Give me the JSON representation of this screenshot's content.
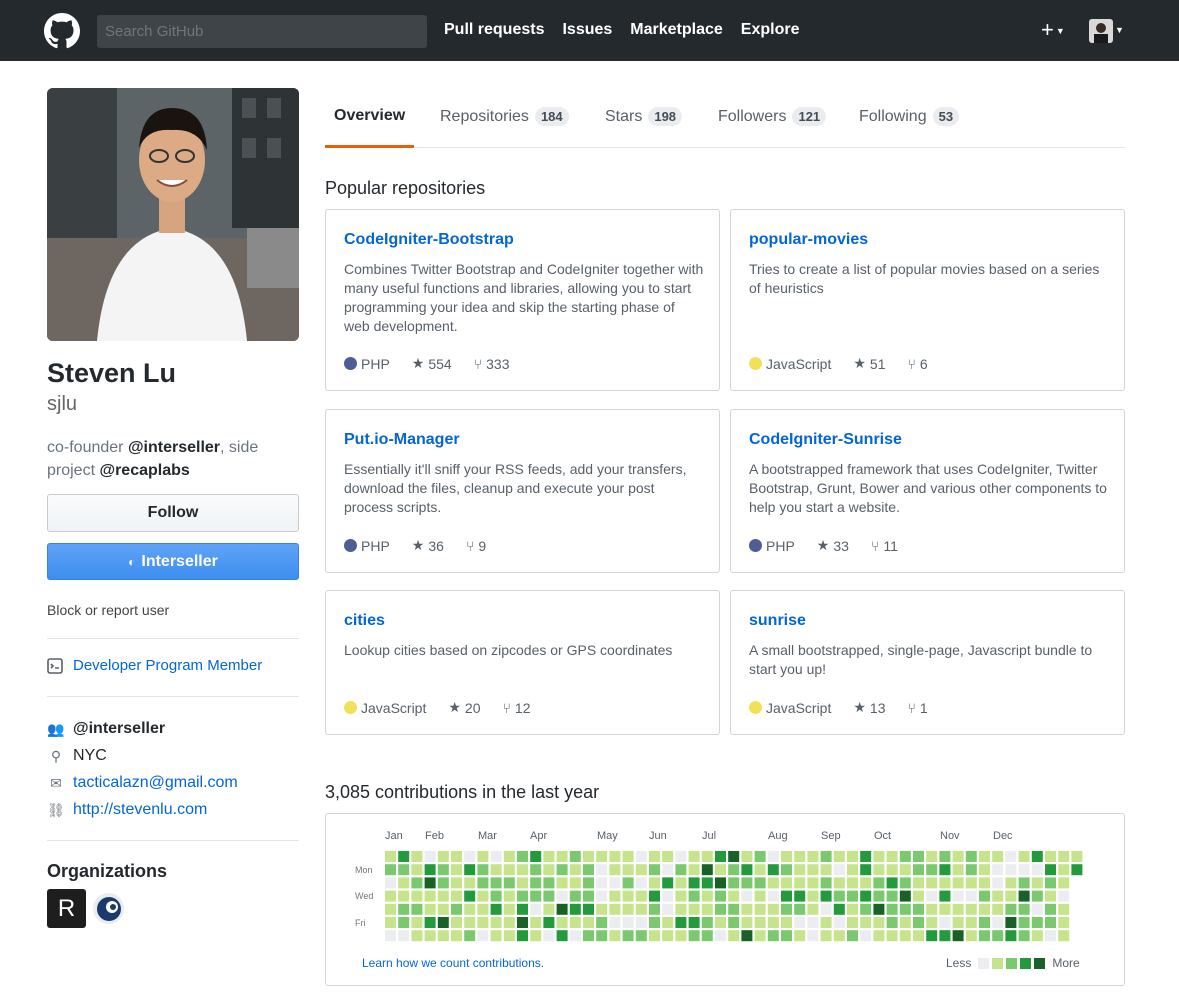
{
  "header": {
    "search_placeholder": "Search GitHub",
    "nav": [
      "Pull requests",
      "Issues",
      "Marketplace",
      "Explore"
    ],
    "plus": "+"
  },
  "profile": {
    "name": "Steven Lu",
    "login": "sjlu",
    "bio_prefix": "co-founder ",
    "bio_org1": "@interseller",
    "bio_mid": ", side project ",
    "bio_org2": "@recaplabs",
    "follow_label": "Follow",
    "org_button_label": "Interseller",
    "block_label": "Block or report user",
    "developer_label": "Developer Program Member",
    "company": "@interseller",
    "location": "NYC",
    "email": "tacticalazn@gmail.com",
    "website": "http://stevenlu.com",
    "orgs_title": "Organizations",
    "org_r_letter": "R"
  },
  "tabs": [
    {
      "label": "Overview",
      "count": ""
    },
    {
      "label": "Repositories",
      "count": "184"
    },
    {
      "label": "Stars",
      "count": "198"
    },
    {
      "label": "Followers",
      "count": "121"
    },
    {
      "label": "Following",
      "count": "53"
    }
  ],
  "popular_title": "Popular repositories",
  "repos": [
    {
      "name": "CodeIgniter-Bootstrap",
      "desc": "Combines Twitter Bootstrap and CodeIgniter together with many useful functions and libraries, allowing you to start programming your idea and skip the starting phase of web development.",
      "lang": "PHP",
      "lang_color": "#4F5D95",
      "stars": "554",
      "forks": "333"
    },
    {
      "name": "popular-movies",
      "desc": "Tries to create a list of popular movies based on a series of heuristics",
      "lang": "JavaScript",
      "lang_color": "#f1e05a",
      "stars": "51",
      "forks": "6"
    },
    {
      "name": "Put.io-Manager",
      "desc": "Essentially it'll sniff your RSS feeds, add your transfers, download the files, cleanup and execute your post process scripts.",
      "lang": "PHP",
      "lang_color": "#4F5D95",
      "stars": "36",
      "forks": "9"
    },
    {
      "name": "CodeIgniter-Sunrise",
      "desc": "A bootstrapped framework that uses CodeIgniter, Twitter Bootstrap, Grunt, Bower and various other components to help you start a website.",
      "lang": "PHP",
      "lang_color": "#4F5D95",
      "stars": "33",
      "forks": "11"
    },
    {
      "name": "cities",
      "desc": "Lookup cities based on zipcodes or GPS coordinates",
      "lang": "JavaScript",
      "lang_color": "#f1e05a",
      "stars": "20",
      "forks": "12"
    },
    {
      "name": "sunrise",
      "desc": "A small bootstrapped, single-page, Javascript bundle to start you up!",
      "lang": "JavaScript",
      "lang_color": "#f1e05a",
      "stars": "13",
      "forks": "1"
    }
  ],
  "contrib": {
    "title": "3,085 contributions in the last year",
    "months": [
      "Jan",
      "Feb",
      "Mar",
      "Apr",
      "May",
      "Jun",
      "Jul",
      "Aug",
      "Sep",
      "Oct",
      "Nov",
      "Dec"
    ],
    "day_labels": [
      "Mon",
      "Wed",
      "Fri"
    ],
    "learn": "Learn how we count contributions.",
    "less": "Less",
    "more": "More",
    "colors": [
      "#ebedf0",
      "#c6e48b",
      "#7bc96f",
      "#239a3b",
      "#196127"
    ]
  }
}
